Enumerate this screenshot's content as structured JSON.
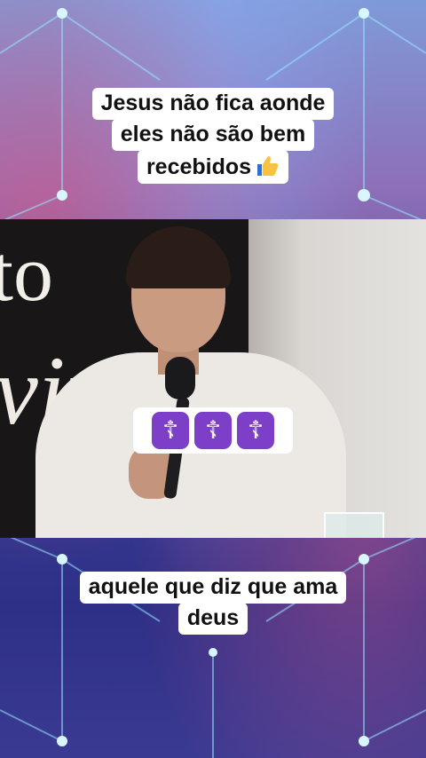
{
  "top_caption": {
    "lines": [
      "Jesus não fica aonde",
      "eles não são bem",
      "recebidos"
    ],
    "emoji": "thumbs-up-icon"
  },
  "emoji_row": {
    "glyph": "☦",
    "count": 3,
    "color": "#7d3fc7"
  },
  "bottom_caption": {
    "lines": [
      "aquele que diz que ama",
      "deus"
    ]
  },
  "background": {
    "colors": [
      "#7f9ad8",
      "#8d6fb8",
      "#3c3f98",
      "#2e2f86"
    ]
  }
}
